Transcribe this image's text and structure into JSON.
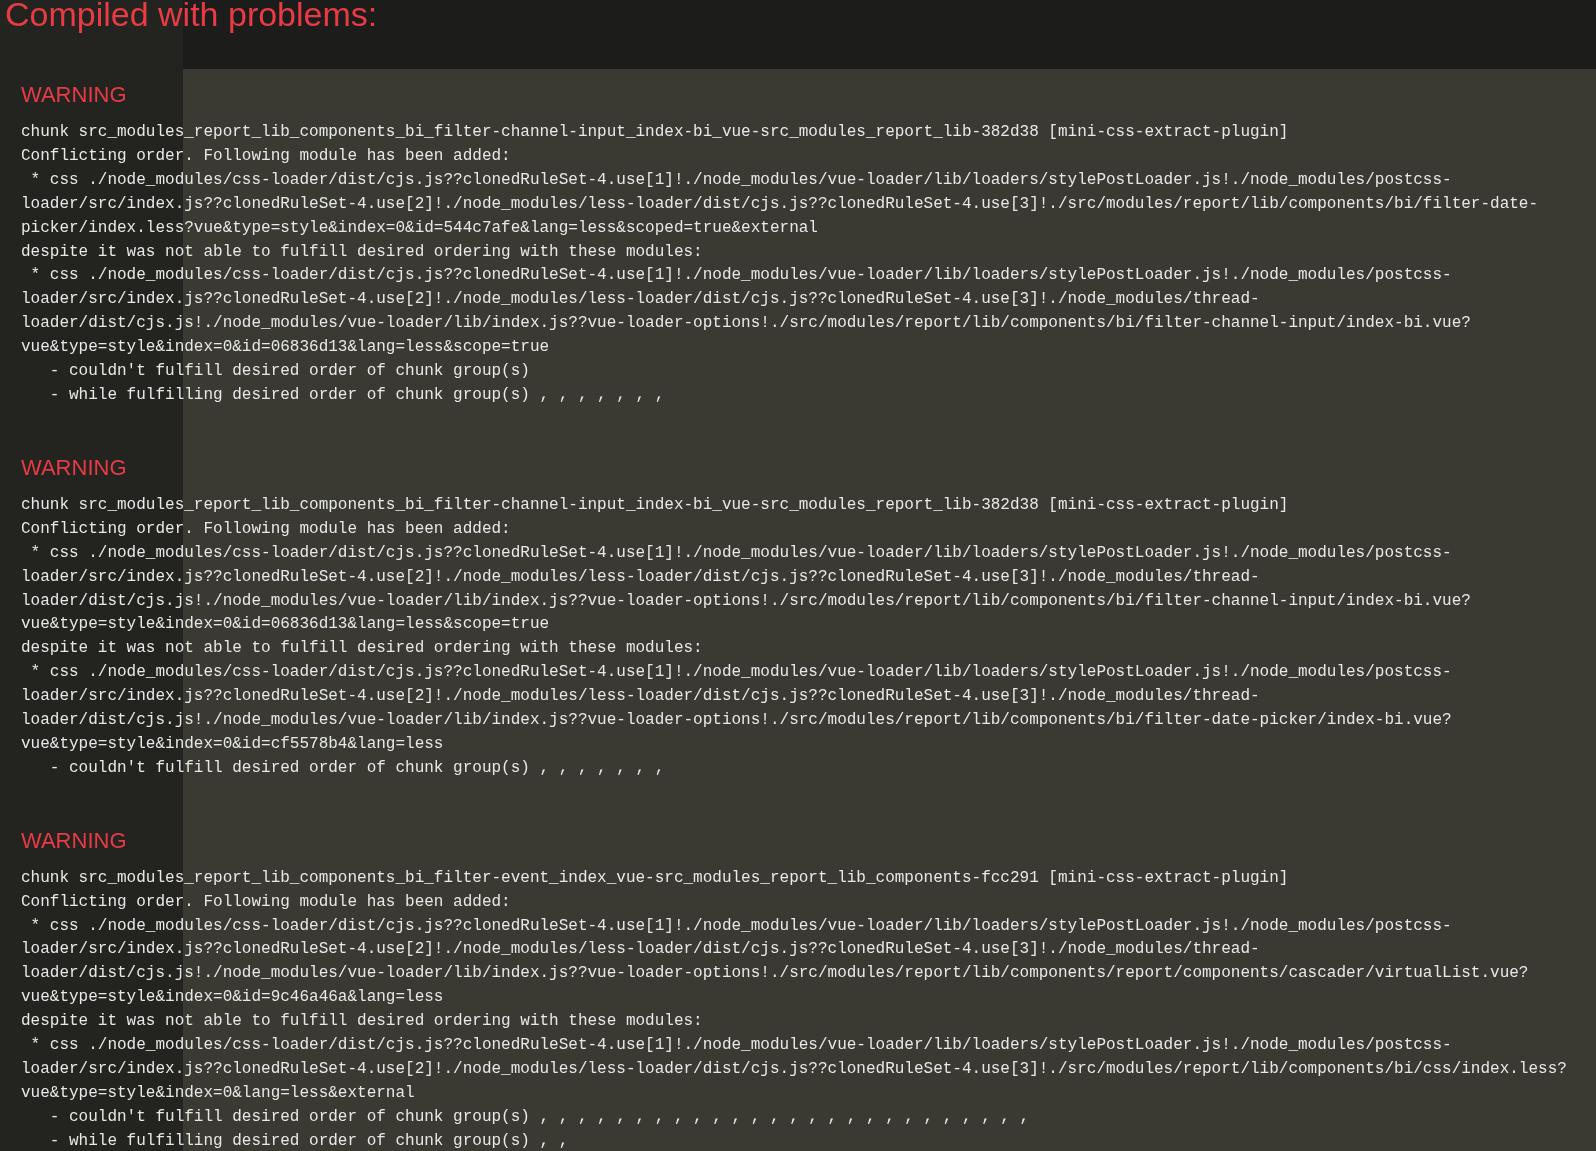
{
  "overlay": {
    "title": "Compiled with problems:",
    "warnings": [
      {
        "label": "WARNING",
        "lines": [
          "chunk src_modules_report_lib_components_bi_filter-channel-input_index-bi_vue-src_modules_report_lib-382d38 [mini-css-extract-plugin]",
          "Conflicting order. Following module has been added:",
          " * css ./node_modules/css-loader/dist/cjs.js??clonedRuleSet-4.use[1]!./node_modules/vue-loader/lib/loaders/stylePostLoader.js!./node_modules/postcss-",
          "loader/src/index.js??clonedRuleSet-4.use[2]!./node_modules/less-loader/dist/cjs.js??clonedRuleSet-4.use[3]!./src/modules/report/lib/components/bi/filter-date-",
          "picker/index.less?vue&type=style&index=0&id=544c7afe&lang=less&scoped=true&external",
          "despite it was not able to fulfill desired ordering with these modules:",
          " * css ./node_modules/css-loader/dist/cjs.js??clonedRuleSet-4.use[1]!./node_modules/vue-loader/lib/loaders/stylePostLoader.js!./node_modules/postcss-",
          "loader/src/index.js??clonedRuleSet-4.use[2]!./node_modules/less-loader/dist/cjs.js??clonedRuleSet-4.use[3]!./node_modules/thread-",
          "loader/dist/cjs.js!./node_modules/vue-loader/lib/index.js??vue-loader-options!./src/modules/report/lib/components/bi/filter-channel-input/index-bi.vue?",
          "vue&type=style&index=0&id=06836d13&lang=less&scope=true",
          "   - couldn't fulfill desired order of chunk group(s)",
          "   - while fulfilling desired order of chunk group(s) , , , , , , ,"
        ]
      },
      {
        "label": "WARNING",
        "lines": [
          "chunk src_modules_report_lib_components_bi_filter-channel-input_index-bi_vue-src_modules_report_lib-382d38 [mini-css-extract-plugin]",
          "Conflicting order. Following module has been added:",
          " * css ./node_modules/css-loader/dist/cjs.js??clonedRuleSet-4.use[1]!./node_modules/vue-loader/lib/loaders/stylePostLoader.js!./node_modules/postcss-",
          "loader/src/index.js??clonedRuleSet-4.use[2]!./node_modules/less-loader/dist/cjs.js??clonedRuleSet-4.use[3]!./node_modules/thread-",
          "loader/dist/cjs.js!./node_modules/vue-loader/lib/index.js??vue-loader-options!./src/modules/report/lib/components/bi/filter-channel-input/index-bi.vue?",
          "vue&type=style&index=0&id=06836d13&lang=less&scope=true",
          "despite it was not able to fulfill desired ordering with these modules:",
          " * css ./node_modules/css-loader/dist/cjs.js??clonedRuleSet-4.use[1]!./node_modules/vue-loader/lib/loaders/stylePostLoader.js!./node_modules/postcss-",
          "loader/src/index.js??clonedRuleSet-4.use[2]!./node_modules/less-loader/dist/cjs.js??clonedRuleSet-4.use[3]!./node_modules/thread-",
          "loader/dist/cjs.js!./node_modules/vue-loader/lib/index.js??vue-loader-options!./src/modules/report/lib/components/bi/filter-date-picker/index-bi.vue?",
          "vue&type=style&index=0&id=cf5578b4&lang=less",
          "   - couldn't fulfill desired order of chunk group(s) , , , , , , ,"
        ]
      },
      {
        "label": "WARNING",
        "lines": [
          "chunk src_modules_report_lib_components_bi_filter-event_index_vue-src_modules_report_lib_components-fcc291 [mini-css-extract-plugin]",
          "Conflicting order. Following module has been added:",
          " * css ./node_modules/css-loader/dist/cjs.js??clonedRuleSet-4.use[1]!./node_modules/vue-loader/lib/loaders/stylePostLoader.js!./node_modules/postcss-",
          "loader/src/index.js??clonedRuleSet-4.use[2]!./node_modules/less-loader/dist/cjs.js??clonedRuleSet-4.use[3]!./node_modules/thread-",
          "loader/dist/cjs.js!./node_modules/vue-loader/lib/index.js??vue-loader-options!./src/modules/report/lib/components/report/components/cascader/virtualList.vue?",
          "vue&type=style&index=0&id=9c46a46a&lang=less",
          "despite it was not able to fulfill desired ordering with these modules:",
          " * css ./node_modules/css-loader/dist/cjs.js??clonedRuleSet-4.use[1]!./node_modules/vue-loader/lib/loaders/stylePostLoader.js!./node_modules/postcss-",
          "loader/src/index.js??clonedRuleSet-4.use[2]!./node_modules/less-loader/dist/cjs.js??clonedRuleSet-4.use[3]!./src/modules/report/lib/components/bi/css/index.less?",
          "vue&type=style&index=0&lang=less&external",
          "   - couldn't fulfill desired order of chunk group(s) , , , , , , , , , , , , , , , , , , , , , , , , , ,",
          "   - while fulfilling desired order of chunk group(s) , ,"
        ]
      }
    ]
  }
}
